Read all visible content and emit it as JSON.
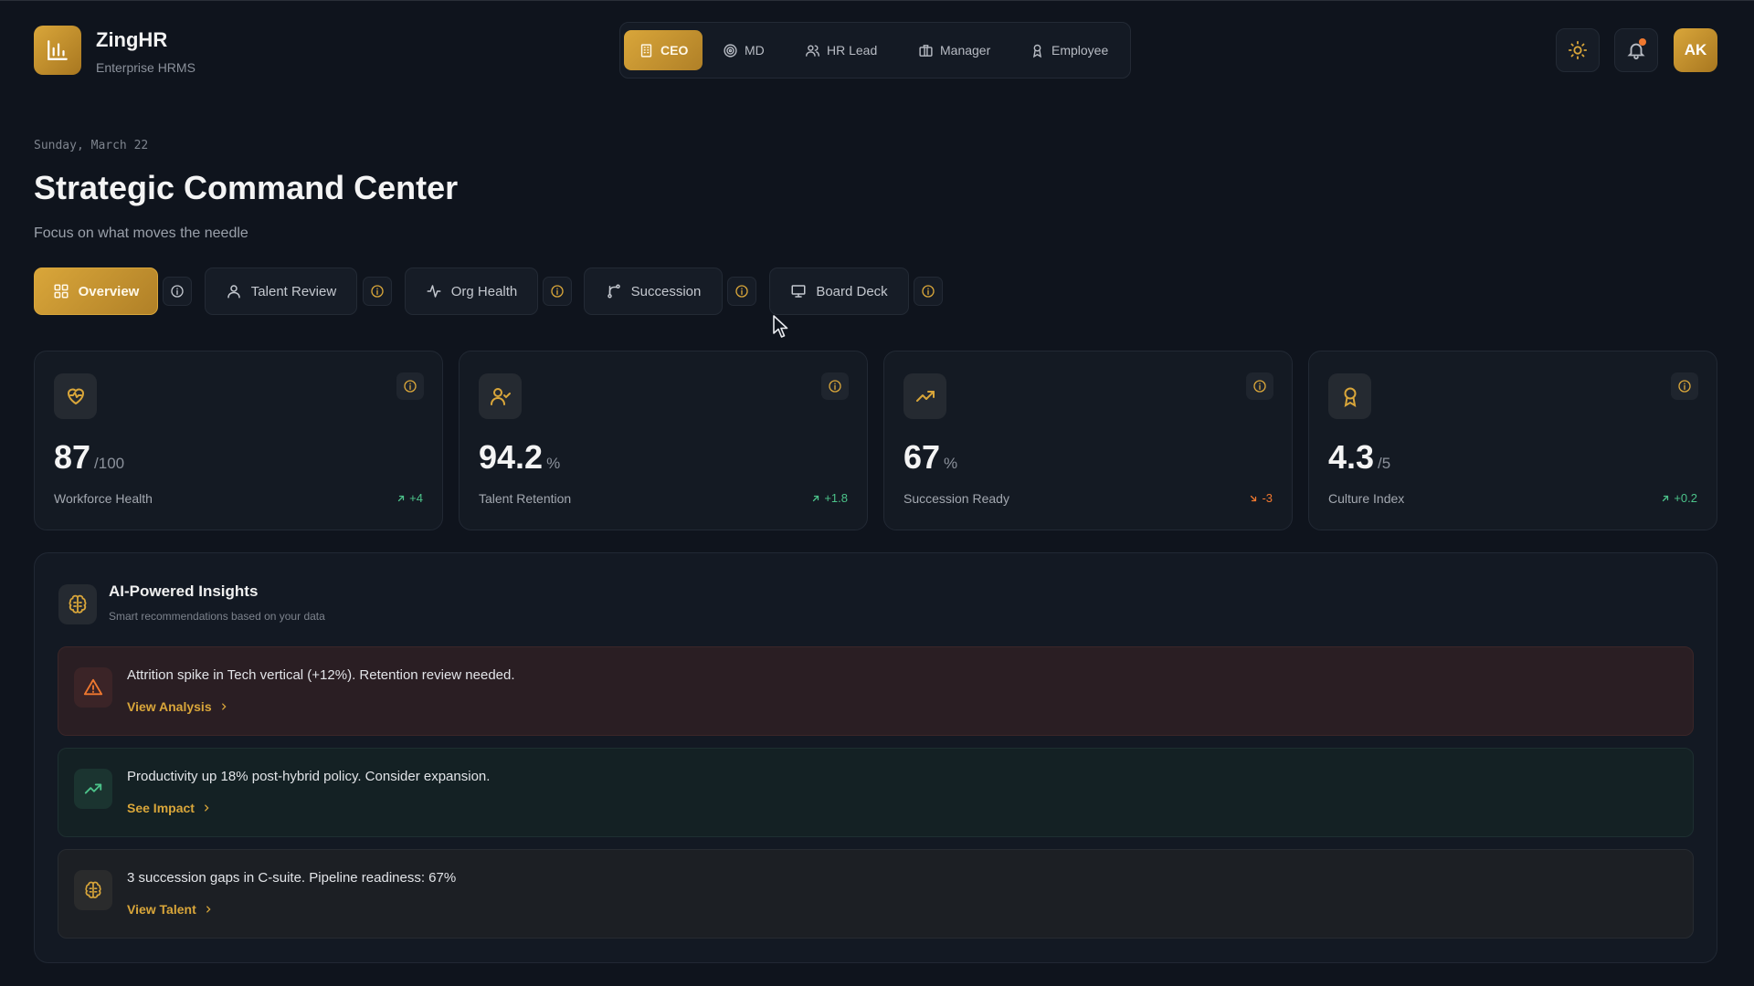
{
  "brand": {
    "name": "ZingHR",
    "subtitle": "Enterprise HRMS"
  },
  "roles": [
    {
      "label": "CEO",
      "icon": "building-icon",
      "active": true
    },
    {
      "label": "MD",
      "icon": "target-icon",
      "active": false
    },
    {
      "label": "HR Lead",
      "icon": "users-icon",
      "active": false
    },
    {
      "label": "Manager",
      "icon": "briefcase-icon",
      "active": false
    },
    {
      "label": "Employee",
      "icon": "badge-icon",
      "active": false
    }
  ],
  "header_actions": {
    "theme_icon": "sun-icon",
    "notification_icon": "bell-icon",
    "avatar_initials": "AK"
  },
  "page": {
    "date": "Sunday, March 22",
    "title": "Strategic Command Center",
    "subtitle": "Focus on what moves the needle"
  },
  "tabs": [
    {
      "label": "Overview",
      "icon": "grid-icon",
      "active": true
    },
    {
      "label": "Talent Review",
      "icon": "user-icon",
      "active": false
    },
    {
      "label": "Org Health",
      "icon": "activity-icon",
      "active": false
    },
    {
      "label": "Succession",
      "icon": "branch-icon",
      "active": false
    },
    {
      "label": "Board Deck",
      "icon": "presentation-icon",
      "active": false
    }
  ],
  "metrics": [
    {
      "value": "87",
      "unit": "/100",
      "label": "Workforce Health",
      "delta": "+4",
      "trend": "up",
      "icon": "heart-pulse-icon"
    },
    {
      "value": "94.2",
      "unit": "%",
      "label": "Talent Retention",
      "delta": "+1.8",
      "trend": "up",
      "icon": "user-check-icon"
    },
    {
      "value": "67",
      "unit": "%",
      "label": "Succession Ready",
      "delta": "-3",
      "trend": "down",
      "icon": "trending-up-icon"
    },
    {
      "value": "4.3",
      "unit": "/5",
      "label": "Culture Index",
      "delta": "+0.2",
      "trend": "up",
      "icon": "award-icon"
    }
  ],
  "insights": {
    "title": "AI-Powered Insights",
    "subtitle": "Smart recommendations based on your data",
    "items": [
      {
        "type": "warn",
        "icon": "alert-triangle-icon",
        "text": "Attrition spike in Tech vertical (+12%). Retention review needed.",
        "link": "View Analysis"
      },
      {
        "type": "good",
        "icon": "trending-up-icon",
        "text": "Productivity up 18% post-hybrid policy. Consider expansion.",
        "link": "See Impact"
      },
      {
        "type": "info",
        "icon": "brain-icon",
        "text": "3 succession gaps in C-suite. Pipeline readiness: 67%",
        "link": "View Talent"
      }
    ]
  },
  "colors": {
    "accent": "#d9a63a",
    "background": "#0f141d",
    "positive": "#4cc38a",
    "negative": "#f0782f"
  }
}
